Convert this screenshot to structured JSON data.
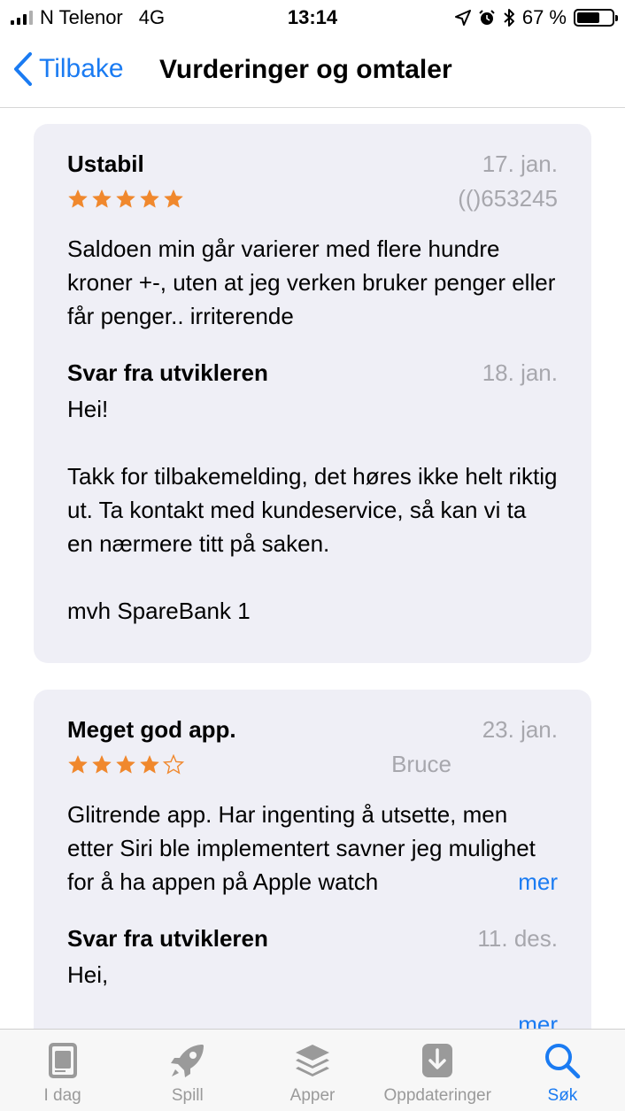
{
  "status_bar": {
    "carrier": "N Telenor",
    "network": "4G",
    "time": "13:14",
    "battery": "67 %",
    "battery_level": 0.67
  },
  "nav": {
    "back_label": "Tilbake",
    "title": "Vurderinger og omtaler"
  },
  "reviews": [
    {
      "title": "Ustabil",
      "date": "17. jan.",
      "rating": 5,
      "author": "(()653245",
      "body": "Saldoen min går varierer med flere hundre kroner +-, uten at jeg verken bruker penger eller får penger.. irriterende",
      "dev_title": "Svar fra utvikleren",
      "dev_date": "18. jan.",
      "dev_reply": "Hei!\n\nTakk for tilbakemelding, det høres ikke helt riktig ut. Ta kontakt med kundeservice, så kan vi ta en nærmere titt på saken.\n\nmvh SpareBank 1"
    },
    {
      "title": "Meget god app.",
      "date": "23. jan.",
      "rating": 4,
      "author": "Bruce",
      "body": "Glitrende app. Har ingenting å utsette, men etter Siri ble implementert savner jeg mulighet for å ha appen på Apple watch",
      "more_label": "mer",
      "dev_title": "Svar fra utvikleren",
      "dev_date": "11. des.",
      "dev_reply": "Hei,",
      "dev_more_label": "mer"
    }
  ],
  "tabs": [
    {
      "label": "I dag",
      "icon": "today-icon",
      "active": false
    },
    {
      "label": "Spill",
      "icon": "rocket-icon",
      "active": false
    },
    {
      "label": "Apper",
      "icon": "layers-icon",
      "active": false
    },
    {
      "label": "Oppdateringer",
      "icon": "download-icon",
      "active": false
    },
    {
      "label": "Søk",
      "icon": "search-icon",
      "active": true
    }
  ],
  "colors": {
    "accent": "#1a7bf2",
    "star": "#f0882d",
    "card_bg": "#efeff6",
    "muted": "#a7a7ad"
  }
}
